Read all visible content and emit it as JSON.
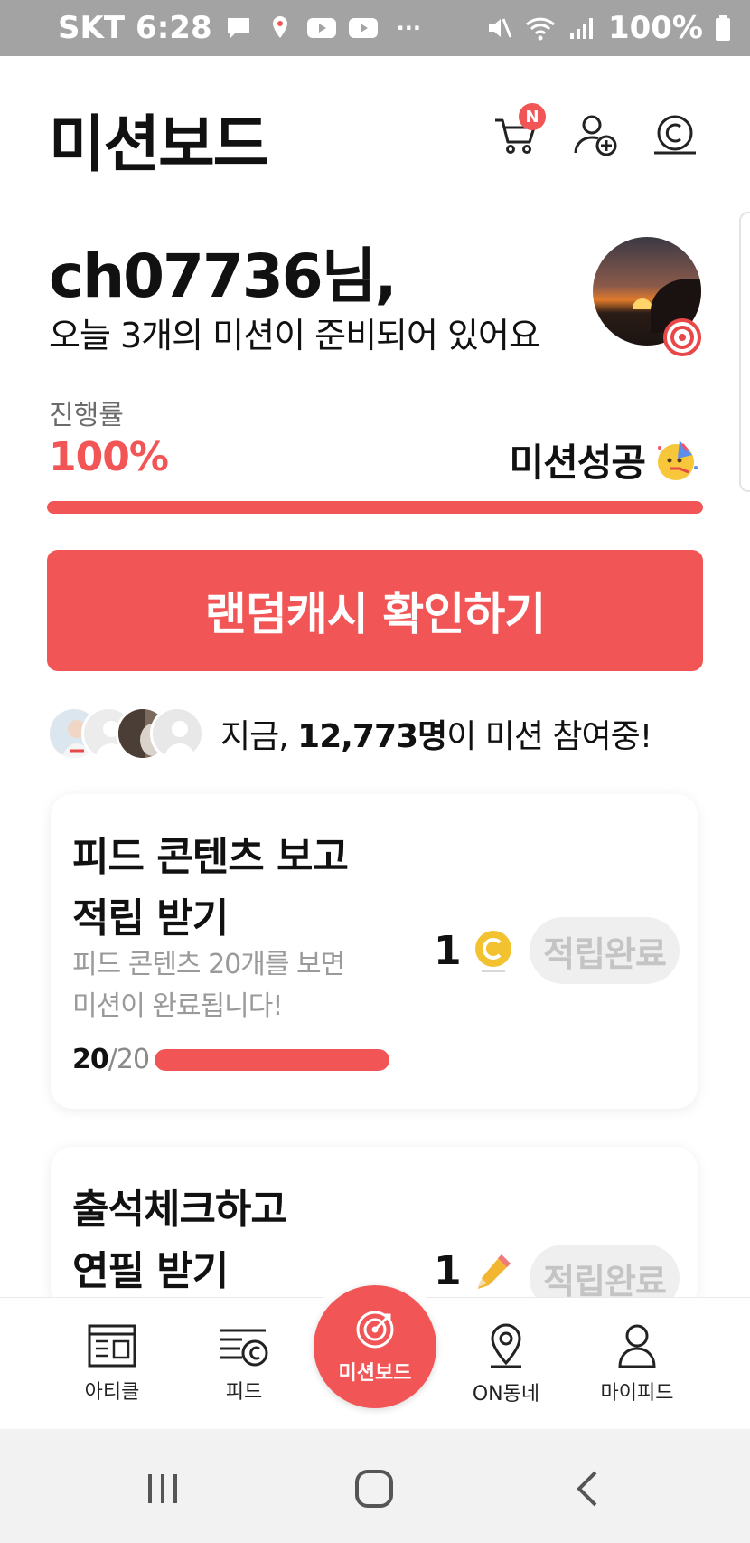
{
  "status_bar": {
    "carrier": "SKT",
    "time": "6:28",
    "more": "···",
    "battery": "100%"
  },
  "header": {
    "title": "미션보드",
    "cart_badge": "N",
    "icons": [
      "cart-icon",
      "add-friend-icon",
      "coin-icon"
    ]
  },
  "greeting": {
    "name_line": "ch07736님,",
    "subtitle": "오늘 3개의 미션이 준비되어 있어요"
  },
  "progress": {
    "label": "진행률",
    "value_text": "100%",
    "fraction": 1.0,
    "status": "미션성공"
  },
  "random_cash_button": "랜덤캐시 확인하기",
  "participants": {
    "prefix": "지금, ",
    "count": "12,773명",
    "suffix": "이 미션 참여중!"
  },
  "missions": [
    {
      "title": "피드 콘텐츠 보고\n적립 받기",
      "description": "피드 콘텐츠 20개를 보면\n미션이 완료됩니다!",
      "current": "20",
      "total": "/20",
      "fraction": 1.0,
      "reward": "1",
      "reward_icon": "coin-icon",
      "status": "적립완료"
    },
    {
      "title": "출석체크하고\n연필 받기",
      "reward": "1",
      "reward_icon": "pencil-icon",
      "status": "적립완료"
    }
  ],
  "bottom_nav": {
    "article": "아티클",
    "feed": "피드",
    "mission_board": "미션보드",
    "on_town": "ON동네",
    "my_feed": "마이피드"
  },
  "colors": {
    "accent": "#f25555",
    "status_bar": "#a3a3a3",
    "coin": "#f2c230"
  }
}
